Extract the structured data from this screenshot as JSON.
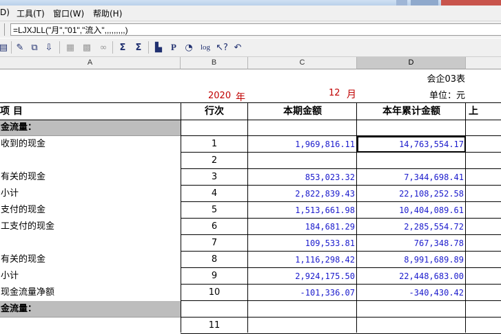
{
  "menu": {
    "items": [
      "D)",
      "工具(T)",
      "窗口(W)",
      "帮助(H)"
    ]
  },
  "formula": {
    "text": "=LJXJLL(\"月\",\"01\",\"流入\",,,,,,,,,)"
  },
  "columns": [
    "A",
    "B",
    "C",
    "D"
  ],
  "report": {
    "code": "会企03表",
    "unit": "单位：元",
    "year": "2020",
    "year_suffix": "年",
    "month": "12",
    "month_suffix": "月"
  },
  "table": {
    "headers": {
      "item": "项        目",
      "row": "行次",
      "current": "本期金额",
      "ytd": "本年累计金额",
      "prev": "上"
    },
    "rows": [
      {
        "label": "金流量：",
        "row": "",
        "current": "",
        "ytd": "",
        "section": true
      },
      {
        "label": "收到的现金",
        "row": "1",
        "current": "1,969,816.11",
        "ytd": "14,763,554.17"
      },
      {
        "label": "",
        "row": "2",
        "current": "",
        "ytd": ""
      },
      {
        "label": "有关的现金",
        "row": "3",
        "current": "853,023.32",
        "ytd": "7,344,698.41"
      },
      {
        "label": "小计",
        "row": "4",
        "current": "2,822,839.43",
        "ytd": "22,108,252.58"
      },
      {
        "label": "支付的现金",
        "row": "5",
        "current": "1,513,661.98",
        "ytd": "10,404,089.61"
      },
      {
        "label": "工支付的现金",
        "row": "6",
        "current": "184,681.29",
        "ytd": "2,285,554.72"
      },
      {
        "label": "",
        "row": "7",
        "current": "109,533.81",
        "ytd": "767,348.78"
      },
      {
        "label": "有关的现金",
        "row": "8",
        "current": "1,116,298.42",
        "ytd": "8,991,689.89"
      },
      {
        "label": "小计",
        "row": "9",
        "current": "2,924,175.50",
        "ytd": "22,448,683.00"
      },
      {
        "label": "现金流量净额",
        "row": "10",
        "current": "-101,336.07",
        "ytd": "-340,430.42"
      },
      {
        "label": "金流量：",
        "row": "",
        "current": "",
        "ytd": "",
        "section": true
      },
      {
        "label": "",
        "row": "11",
        "current": "",
        "ytd": ""
      }
    ]
  },
  "toolbar": {
    "icons": [
      "print-icon",
      "edit-icon",
      "copy-icon",
      "filter-icon",
      "grid-icon",
      "grid2-icon",
      "binoculars-icon",
      "sum-icon",
      "sum-all-icon",
      "chart-icon",
      "p-icon",
      "pie-icon",
      "log-icon",
      "help-pointer-icon",
      "undo-icon"
    ]
  }
}
